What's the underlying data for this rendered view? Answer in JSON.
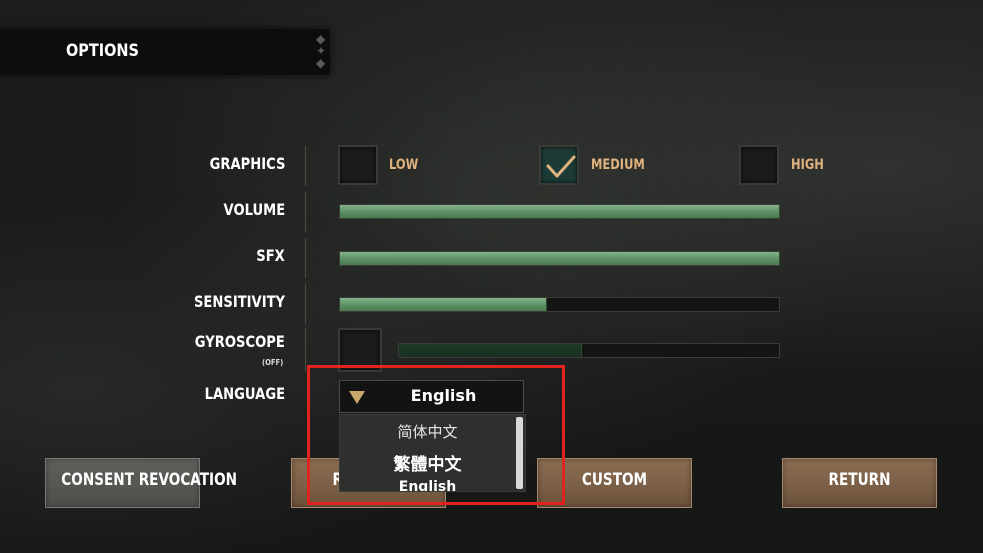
{
  "header": {
    "title": "OPTIONS"
  },
  "settings": {
    "graphics": {
      "label": "GRAPHICS",
      "options": [
        {
          "label": "LOW",
          "checked": false
        },
        {
          "label": "MEDIUM",
          "checked": true
        },
        {
          "label": "HIGH",
          "checked": false
        }
      ]
    },
    "volume": {
      "label": "VOLUME",
      "level_percent": 100
    },
    "sfx": {
      "label": "SFX",
      "level_percent": 100
    },
    "sensitivity": {
      "label": "SENSITIVITY",
      "level_percent": 47
    },
    "gyroscope": {
      "label": "GYROSCOPE",
      "state": "(OFF)",
      "checked": false,
      "level_percent": 48
    },
    "language": {
      "label": "LANGUAGE",
      "selected": "English",
      "options": [
        "简体中文",
        "繁體中文",
        "English"
      ]
    }
  },
  "buttons": {
    "consent": "CONSENT REVOCATION",
    "second": "RE",
    "custom": "CUSTOM",
    "return": "RETURN"
  },
  "colors": {
    "slider_fill": "#6fa277",
    "quality_label": "#e0b27d",
    "highlight": "#e0231e",
    "button": "#7a5e46"
  },
  "icons": {
    "check": "check-icon",
    "dropdown": "triangle-down-icon"
  }
}
